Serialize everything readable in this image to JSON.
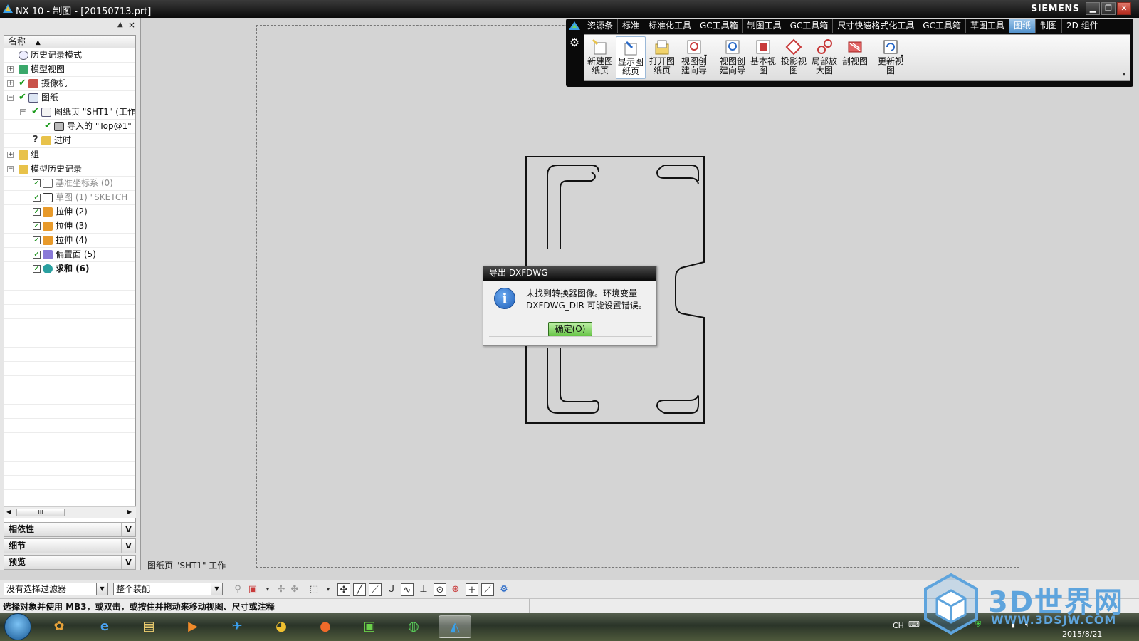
{
  "window": {
    "title": "NX 10 - 制图 - [20150713.prt]",
    "brand": "SIEMENS",
    "min_label": "▁",
    "restore_label": "❐",
    "close_label": "✕"
  },
  "navigator": {
    "column_header": "名称",
    "sort_indicator": "▲",
    "rows": [
      {
        "label": "历史记录模式",
        "icon": "clock-icon",
        "expand": ""
      },
      {
        "label": "模型视图",
        "icon": "model-views-icon",
        "expand": "+"
      },
      {
        "label": "摄像机",
        "icon": "camera-icon",
        "expand": "+"
      },
      {
        "label": "图纸",
        "icon": "drawing-icon",
        "expand": "−"
      },
      {
        "label": "图纸页 \"SHT1\" (工作",
        "icon": "sheet-icon",
        "expand": "−"
      },
      {
        "label": "导入的 \"Top@1\"",
        "icon": "imported-view-icon",
        "expand": ""
      },
      {
        "label": "过时",
        "icon": "folder-icon",
        "expand": ""
      },
      {
        "label": "组",
        "icon": "folder-icon",
        "expand": "+"
      },
      {
        "label": "模型历史记录",
        "icon": "folder-icon",
        "expand": "−"
      },
      {
        "label": "基准坐标系 (0)",
        "icon": "datum-csys-icon",
        "expand": ""
      },
      {
        "label": "草图 (1) \"SKETCH_",
        "icon": "sketch-icon",
        "expand": ""
      },
      {
        "label": "拉伸 (2)",
        "icon": "extrude-icon",
        "expand": ""
      },
      {
        "label": "拉伸 (3)",
        "icon": "extrude-icon",
        "expand": ""
      },
      {
        "label": "拉伸 (4)",
        "icon": "extrude-icon",
        "expand": ""
      },
      {
        "label": "偏置面 (5)",
        "icon": "offset-face-icon",
        "expand": ""
      },
      {
        "label": "求和 (6)",
        "icon": "unite-icon",
        "expand": ""
      }
    ],
    "scroll_thumb": "III"
  },
  "panels": {
    "dependencies": "相依性",
    "details": "细节",
    "preview": "预览"
  },
  "sheet_label": "图纸页 \"SHT1\" 工作",
  "ribbon": {
    "tabs": [
      "资源条",
      "标准",
      "标准化工具 - GC工具箱",
      "制图工具 - GC工具箱",
      "尺寸快速格式化工具 - GC工具箱",
      "草图工具",
      "图纸",
      "制图",
      "2D 组件"
    ],
    "active_tab": "图纸",
    "buttons": [
      {
        "label": "新建图\n纸页",
        "icon": "new-sheet-icon"
      },
      {
        "label": "显示图\n纸页",
        "icon": "display-sheet-icon"
      },
      {
        "label": "打开图\n纸页",
        "icon": "open-sheet-icon"
      },
      {
        "label": "视图创\n建向导",
        "icon": "view-wizard-icon"
      },
      {
        "label": "视图创\n建向导",
        "icon": "view-wizard2-icon"
      },
      {
        "label": "基本视\n图",
        "icon": "base-view-icon"
      },
      {
        "label": "投影视\n图",
        "icon": "projected-view-icon"
      },
      {
        "label": "局部放\n大图",
        "icon": "detail-view-icon"
      },
      {
        "label": "剖视图",
        "icon": "section-view-icon"
      },
      {
        "label": "更新视\n图",
        "icon": "update-views-icon"
      }
    ]
  },
  "dialog": {
    "title": "导出 DXFDWG",
    "message_line1": "未找到转换器图像。环境变量",
    "message_line2": "DXFDWG_DIR 可能设置错误。",
    "ok_label": "确定(O)"
  },
  "filterbar": {
    "selection_filter": "没有选择过滤器",
    "assembly_scope": "整个装配"
  },
  "status": {
    "prompt": "选择对象并使用 MB3，或双击，或按住并拖动来移动视图、尺寸或注释"
  },
  "taskbar": {
    "tray_lang": "CH",
    "date": "2015/8/21"
  },
  "watermark": {
    "text": "3D世界网",
    "url": "WWW.3DSJW.COM"
  }
}
